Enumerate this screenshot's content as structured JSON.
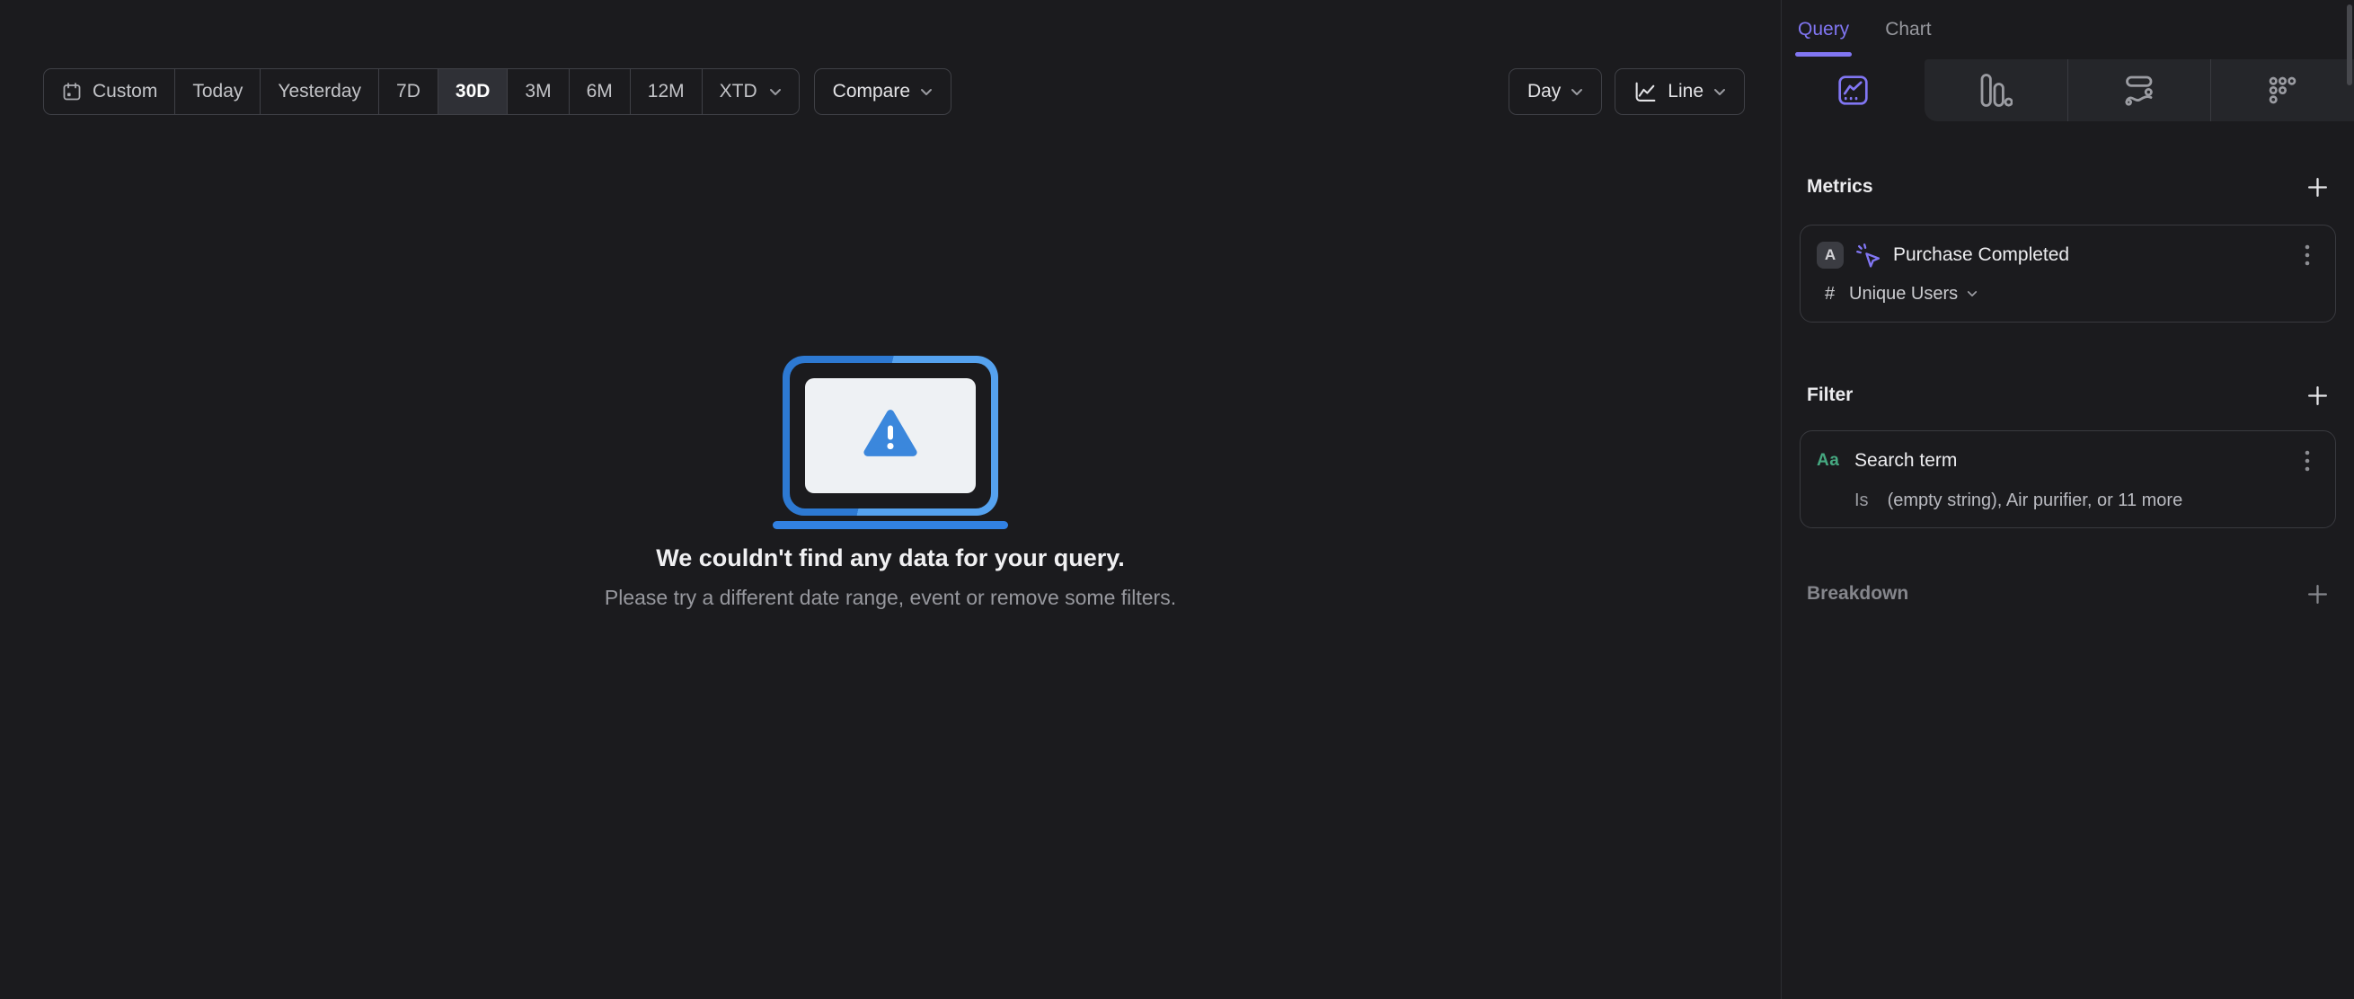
{
  "toolbar": {
    "segments": [
      "Custom",
      "Today",
      "Yesterday",
      "7D",
      "30D",
      "3M",
      "6M",
      "12M",
      "XTD"
    ],
    "selected_segment": "30D",
    "compare_label": "Compare",
    "granularity_label": "Day",
    "chart_type_label": "Line"
  },
  "empty_state": {
    "title": "We couldn't find any data for your query.",
    "subtitle": "Please try a different date range, event or remove some filters."
  },
  "sidebar": {
    "tabs": {
      "query": "Query",
      "chart": "Chart"
    },
    "active_tab": "Query",
    "icon_tabs": [
      "insights",
      "funnels",
      "flows",
      "retention"
    ],
    "metrics": {
      "heading": "Metrics",
      "item": {
        "letter": "A",
        "name": "Purchase Completed",
        "aggregation_symbol": "#",
        "aggregation": "Unique Users"
      }
    },
    "filter": {
      "heading": "Filter",
      "item": {
        "type_label": "Aa",
        "property": "Search term",
        "operator": "Is",
        "value": "(empty string), Air purifier, or 11 more"
      }
    },
    "breakdown": {
      "heading": "Breakdown"
    }
  },
  "colors": {
    "background": "#1b1b1e",
    "accent_purple": "#8176f3",
    "property_green": "#46a981",
    "illustration_blue_dark": "#2d79d2",
    "illustration_blue_light": "#55a2ef",
    "warning_triangle_blue": "#3b87dc",
    "selected_segment_bg": "#2f3036"
  }
}
